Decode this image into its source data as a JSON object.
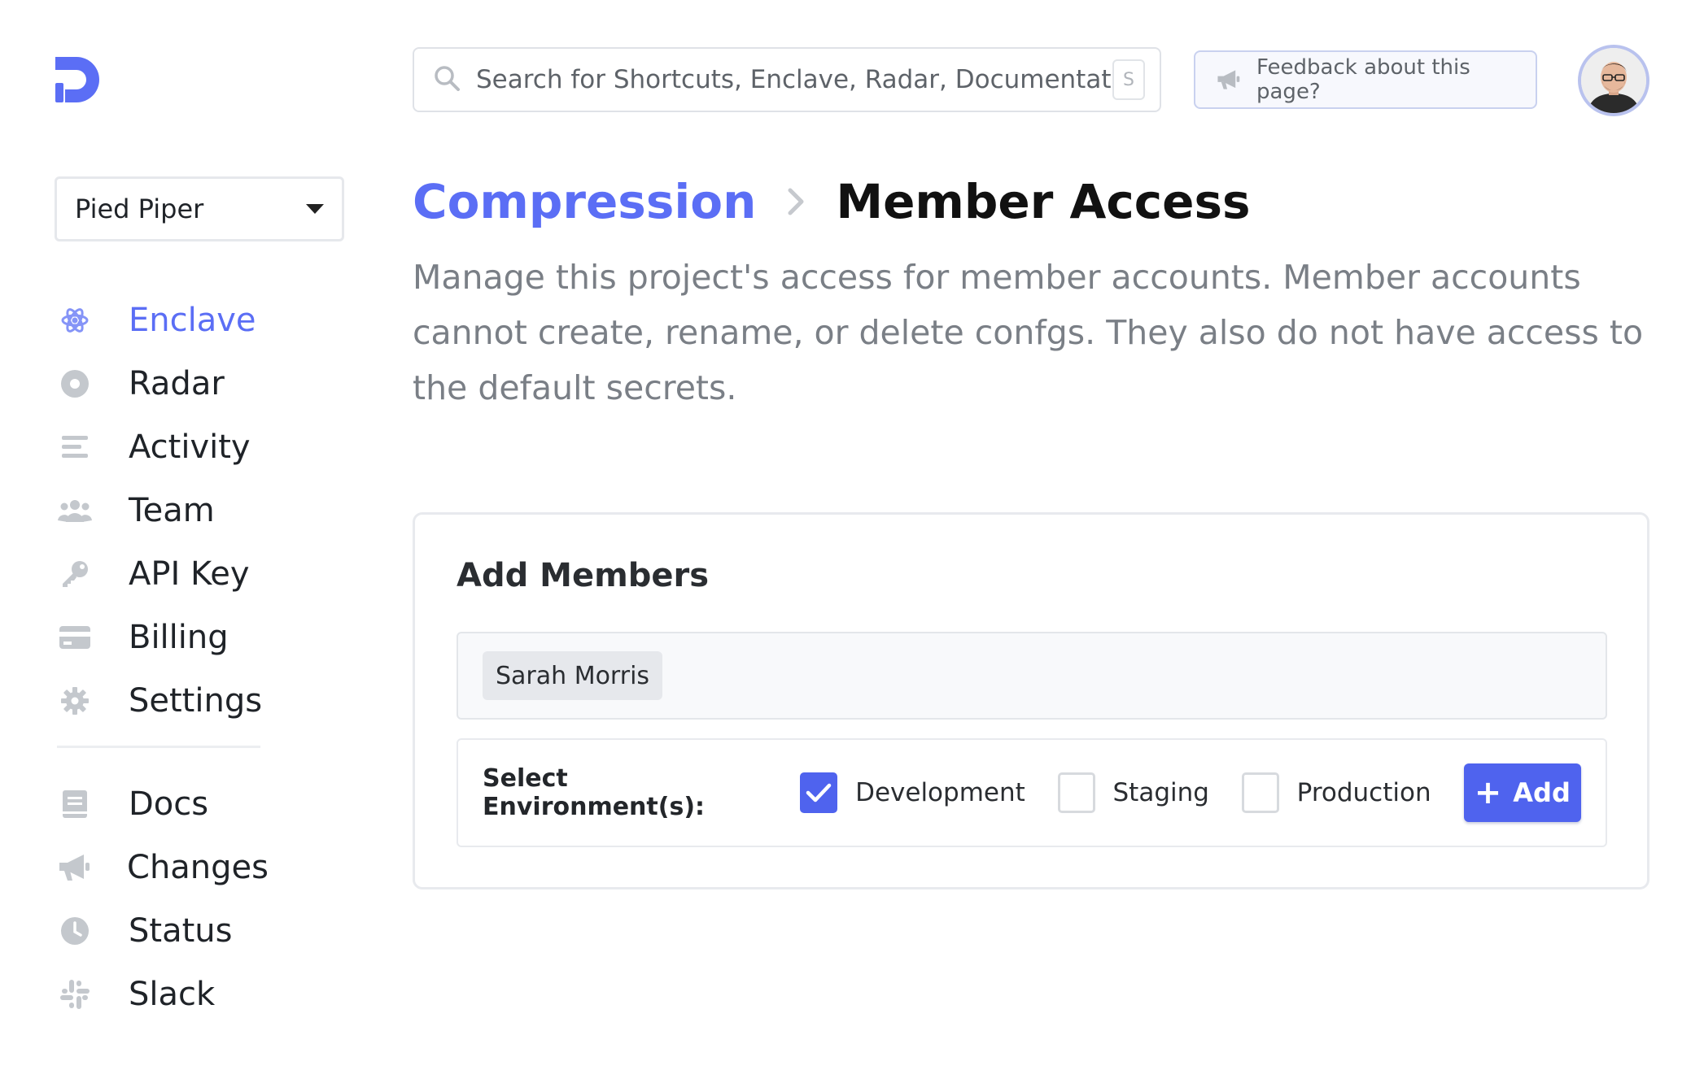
{
  "org_selector": {
    "value": "Pied Piper"
  },
  "search": {
    "placeholder": "Search for Shortcuts, Enclave, Radar, Documentation...",
    "shortcut": "S"
  },
  "feedback": {
    "label": "Feedback about this page?"
  },
  "sidebar": {
    "items": [
      {
        "label": "Enclave",
        "icon": "atom-icon",
        "active": true
      },
      {
        "label": "Radar",
        "icon": "radar-icon"
      },
      {
        "label": "Activity",
        "icon": "activity-list-icon"
      },
      {
        "label": "Team",
        "icon": "team-icon"
      },
      {
        "label": "API Key",
        "icon": "key-icon"
      },
      {
        "label": "Billing",
        "icon": "credit-card-icon"
      },
      {
        "label": "Settings",
        "icon": "gear-icon"
      }
    ],
    "secondary": [
      {
        "label": "Docs",
        "icon": "book-icon"
      },
      {
        "label": "Changes",
        "icon": "megaphone-icon"
      },
      {
        "label": "Status",
        "icon": "clock-icon"
      },
      {
        "label": "Slack",
        "icon": "slack-icon"
      }
    ]
  },
  "breadcrumb": {
    "parent": "Compression",
    "current": "Member Access"
  },
  "description": "Manage this project's access for member accounts. Member accounts cannot create, rename, or delete confgs. They also do not have access to the default secrets.",
  "add_members": {
    "title": "Add Members",
    "selected_members": [
      "Sarah Morris"
    ],
    "env_label": "Select Environment(s):",
    "environments": [
      {
        "label": "Development",
        "checked": true
      },
      {
        "label": "Staging",
        "checked": false
      },
      {
        "label": "Production",
        "checked": false
      }
    ],
    "add_button": "Add"
  },
  "colors": {
    "accent": "#5b6ef5",
    "button": "#4f63ee",
    "muted_text": "#7a7f86",
    "icon_gray": "#c4c8cd"
  }
}
